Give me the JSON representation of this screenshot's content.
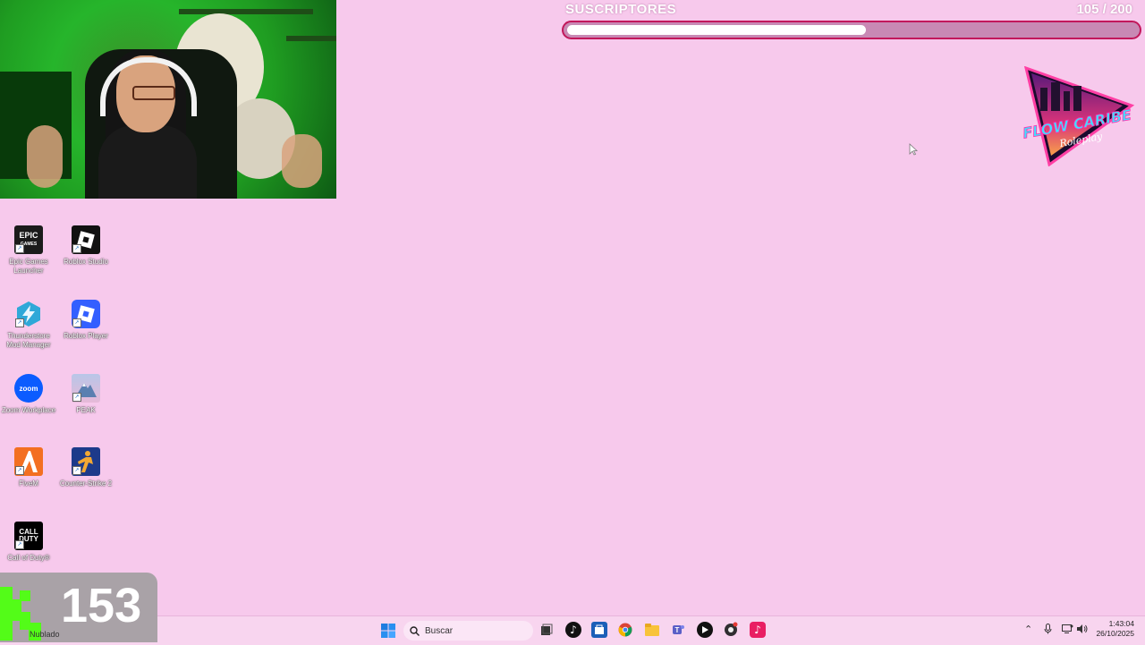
{
  "overlay": {
    "goal_label": "SUSCRIPTORES",
    "goal_current": "105",
    "goal_target": "200",
    "goal_count_text": "105 / 200",
    "goal_fraction": 0.525,
    "counter_value": "153",
    "logo_text_1": "FLOW CARIBE",
    "logo_text_2": "Roleplay"
  },
  "desktop": {
    "icons": [
      {
        "label": "Epic Games Launcher",
        "icon": "epic-games-icon",
        "glyph": "EPIC\nGAMES"
      },
      {
        "label": "Roblox Studio",
        "icon": "roblox-studio-icon"
      },
      {
        "label": "Thunderstore Mod Manager",
        "icon": "thunderstore-icon"
      },
      {
        "label": "Roblox Player",
        "icon": "roblox-player-icon"
      },
      {
        "label": "Zoom Workplace",
        "icon": "zoom-icon",
        "glyph": "zoom"
      },
      {
        "label": "PEAK",
        "icon": "peak-icon"
      },
      {
        "label": "FiveM",
        "icon": "fivem-icon"
      },
      {
        "label": "Counter-Strike 2",
        "icon": "counter-strike-icon"
      },
      {
        "label": "Call of Duty®",
        "icon": "call-of-duty-icon",
        "glyph": "CALL\nDUTY"
      }
    ]
  },
  "taskbar": {
    "weather": "Nublado",
    "search_placeholder": "Buscar",
    "time": "1:43:04",
    "date": "26/10/2025"
  },
  "colors": {
    "background": "#f7c9ec",
    "goal_border": "#c2185b",
    "kick_green": "#53fc18"
  }
}
